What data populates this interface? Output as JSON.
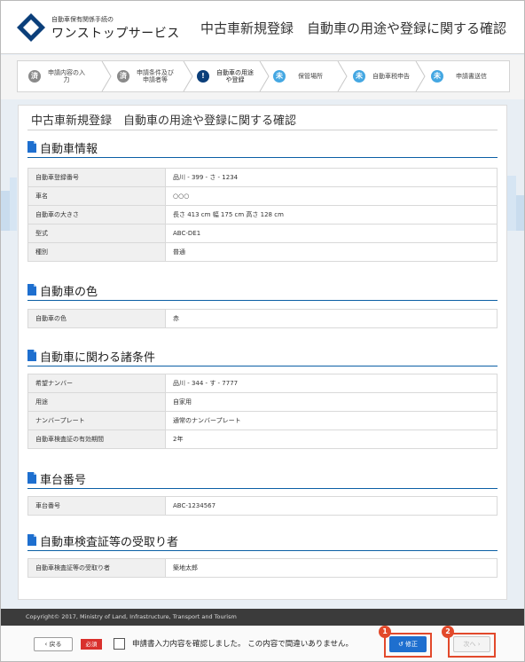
{
  "header": {
    "logo_sub": "自動車保有関係手続の",
    "logo_main": "ワンストップサービス",
    "page_heading": "中古車新規登録　自動車の用途や登録に関する確認"
  },
  "steps": [
    {
      "badge": "済",
      "label": "申請内容の入\n力",
      "state": "done"
    },
    {
      "badge": "済",
      "label": "申請条件及び\n申請者等",
      "state": "done"
    },
    {
      "badge": "!",
      "label": "自動車の用途\nや登録",
      "state": "current"
    },
    {
      "badge": "未",
      "label": "保管場所",
      "state": "todo"
    },
    {
      "badge": "未",
      "label": "自動車税申告",
      "state": "todo"
    },
    {
      "badge": "未",
      "label": "申請書送信",
      "state": "todo"
    }
  ],
  "content_title": "中古車新規登録　自動車の用途や登録に関する確認",
  "sections": [
    {
      "title": "自動車情報",
      "rows": [
        {
          "key": "自動車登録番号",
          "value": "品川 - 399 - さ - 1234"
        },
        {
          "key": "車名",
          "value": "○○○"
        },
        {
          "key": "自動車の大きさ",
          "value": "長さ 413 cm  幅 175 cm  高さ 128 cm"
        },
        {
          "key": "型式",
          "value": "ABC-DE1"
        },
        {
          "key": "種別",
          "value": "普通"
        }
      ]
    },
    {
      "title": "自動車の色",
      "rows": [
        {
          "key": "自動車の色",
          "value": "赤"
        }
      ]
    },
    {
      "title": "自動車に関わる諸条件",
      "rows": [
        {
          "key": "希望ナンバー",
          "value": "品川 - 344 - す - 7777"
        },
        {
          "key": "用途",
          "value": "自家用"
        },
        {
          "key": "ナンバープレート",
          "value": "通常のナンバープレート"
        },
        {
          "key": "自動車検査証の有効期間",
          "value": "2年"
        }
      ]
    },
    {
      "title": "車台番号",
      "rows": [
        {
          "key": "車台番号",
          "value": "ABC-1234567"
        }
      ]
    },
    {
      "title": "自動車検査証等の受取り者",
      "rows": [
        {
          "key": "自動車検査証等の受取り者",
          "value": "築地太郎"
        }
      ]
    }
  ],
  "footer": {
    "copyright": "Copyright© 2017, Ministry of Land, Infrastructure, Transport and Tourism",
    "back_label": "‹ 戻る",
    "required_badge": "必須",
    "confirm_text": "申請書入力内容を確認しました。 この内容で間違いありません。",
    "fix_label": "修正",
    "next_label": "次へ ›",
    "fix_marker": "1",
    "next_marker": "2"
  },
  "colors": {
    "accent_blue": "#1e6fcf",
    "done_gray": "#8a8a8a",
    "todo_blue": "#44a7e2",
    "current_navy": "#0b3f7a",
    "highlight_red": "#e2492b",
    "required_red": "#d9302c"
  },
  "icons": {
    "logo": "diamond-logo-icon",
    "section": "document-icon",
    "fix": "undo-icon"
  }
}
